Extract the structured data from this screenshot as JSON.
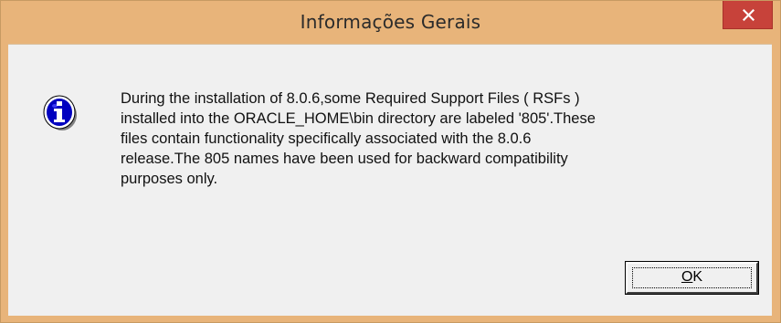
{
  "window": {
    "title": "Informações Gerais",
    "close_icon": "close-icon",
    "titlebar_color": "#e8b47a",
    "close_color": "#c7423a"
  },
  "dialog": {
    "icon": "info-icon",
    "message": "During the installation of 8.0.6,some Required Support Files ( RSFs )\ninstalled into the ORACLE_HOME\\bin directory are labeled '805'.These\nfiles contain functionality specifically associated with the 8.0.6\nrelease.The 805 names have been used for backward compatibility\npurposes only.",
    "ok_button": {
      "mnemonic": "O",
      "rest": "K"
    }
  }
}
